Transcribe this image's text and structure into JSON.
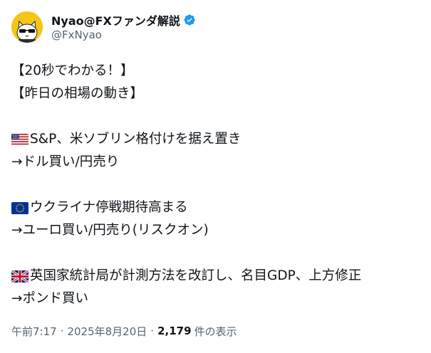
{
  "user": {
    "display_name": "Nyao@FXファンダ解説",
    "handle": "@FxNyao",
    "avatar_icon": "cat-avatar-icon",
    "verified_icon": "verified-badge-icon",
    "verified_color": "#1d9bf0"
  },
  "post": {
    "lines": {
      "l1": "【20秒でわかる！】",
      "l2": "【昨日の相場の動き】",
      "l3": "S&P、米ソブリン格付けを据え置き",
      "l4": "→ドル買い/円売り",
      "l5": "ウクライナ停戦期待高まる",
      "l6": "→ユーロ買い/円売り(リスクオン)",
      "l7": "英国家統計局が計測方法を改訂し、名目GDP、上方修正",
      "l8": "→ポンド買い"
    },
    "flags": {
      "f1": "us-flag-icon",
      "f2": "eu-flag-icon",
      "f3": "uk-flag-icon"
    }
  },
  "meta": {
    "time": "午前7:17",
    "separator": "·",
    "date": "2025年8月20日",
    "views_count": "2,179",
    "views_label": "件の表示"
  },
  "colors": {
    "text": "#0f1419",
    "secondary": "#536471",
    "accent": "#1d9bf0"
  }
}
